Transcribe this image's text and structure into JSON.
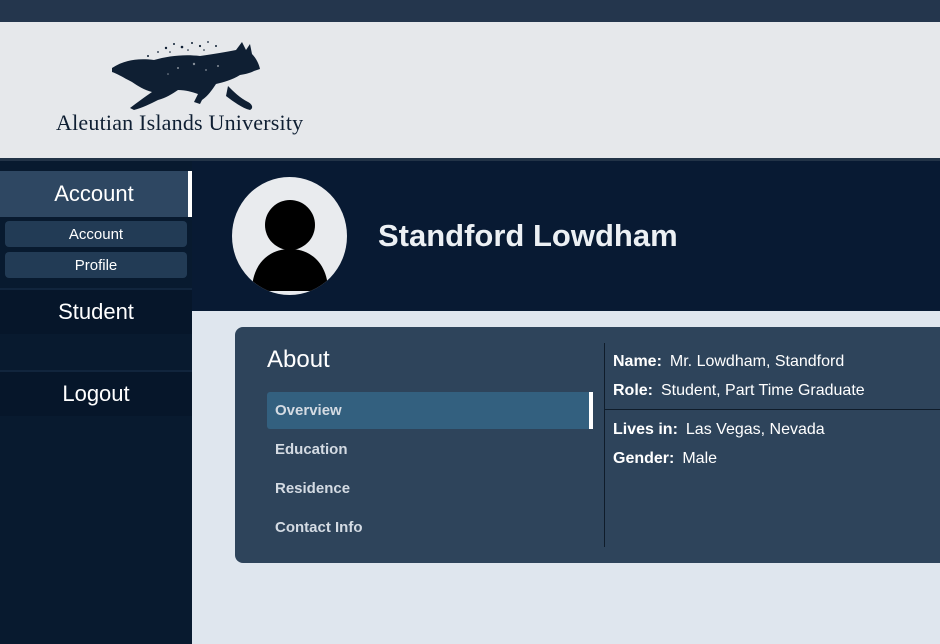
{
  "header": {
    "university_name": "Aleutian Islands University",
    "logo_icon": "running-wolf-logo"
  },
  "sidebar": {
    "account_label": "Account",
    "sub_items": [
      {
        "label": "Account"
      },
      {
        "label": "Profile"
      }
    ],
    "student_label": "Student",
    "logout_label": "Logout"
  },
  "profile": {
    "name": "Standford Lowdham",
    "avatar_icon": "user-silhouette-icon"
  },
  "about": {
    "title": "About",
    "tabs": [
      {
        "label": "Overview",
        "active": true
      },
      {
        "label": "Education",
        "active": false
      },
      {
        "label": "Residence",
        "active": false
      },
      {
        "label": "Contact Info",
        "active": false
      }
    ],
    "fields": [
      {
        "label": "Name:",
        "value": "Mr. Lowdham, Standford"
      },
      {
        "label": "Role:",
        "value": "Student, Part Time Graduate"
      },
      {
        "label": "Lives in:",
        "value": "Las Vegas, Nevada"
      },
      {
        "label": "Gender:",
        "value": "Male"
      }
    ]
  },
  "colors": {
    "sidebar_bg": "#081a2f",
    "banner_bg": "#081a33",
    "card_bg": "#2e445b",
    "active_tab": "#33607f",
    "page_bg": "#dfe6ee"
  }
}
